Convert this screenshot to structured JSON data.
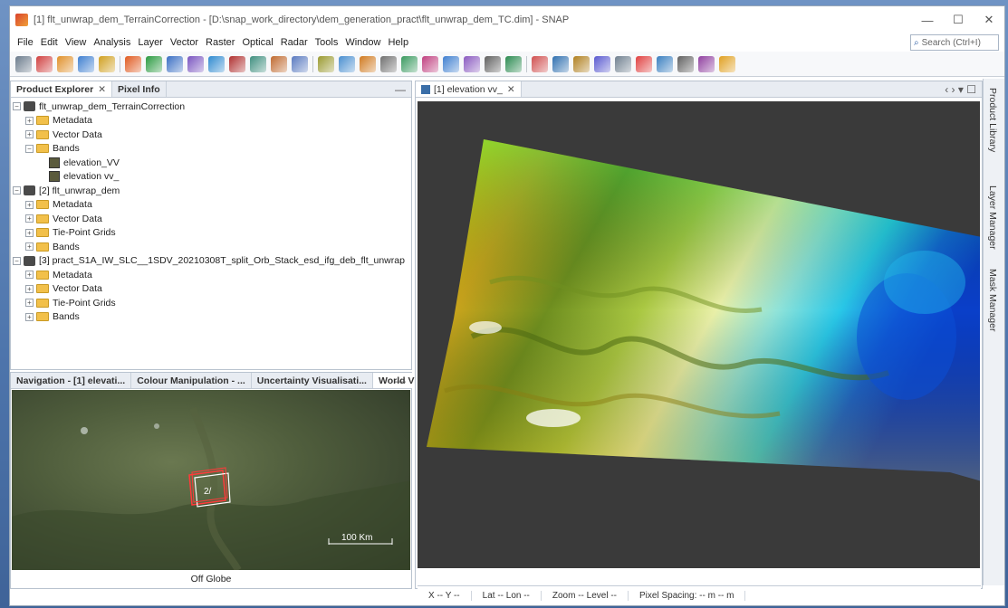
{
  "window": {
    "title": "[1] flt_unwrap_dem_TerrainCorrection - [D:\\snap_work_directory\\dem_generation_pract\\flt_unwrap_dem_TC.dim] - SNAP",
    "min_glyph": "—",
    "max_glyph": "☐",
    "close_glyph": "✕"
  },
  "menu": [
    "File",
    "Edit",
    "View",
    "Analysis",
    "Layer",
    "Vector",
    "Raster",
    "Optical",
    "Radar",
    "Tools",
    "Window",
    "Help"
  ],
  "search": {
    "placeholder": "Search (Ctrl+I)"
  },
  "product_panel": {
    "tabs": [
      {
        "label": "Product Explorer",
        "close": "✕"
      },
      {
        "label": "Pixel Info"
      }
    ],
    "tree": [
      {
        "indent": 0,
        "type": "product",
        "exp": "−",
        "label": "flt_unwrap_dem_TerrainCorrection"
      },
      {
        "indent": 1,
        "type": "folder",
        "exp": "+",
        "label": "Metadata"
      },
      {
        "indent": 1,
        "type": "folder",
        "exp": "+",
        "label": "Vector Data"
      },
      {
        "indent": 1,
        "type": "folder",
        "exp": "−",
        "label": "Bands"
      },
      {
        "indent": 2,
        "type": "band",
        "exp": "",
        "label": "elevation_VV"
      },
      {
        "indent": 2,
        "type": "band",
        "exp": "",
        "label": "elevation vv_"
      },
      {
        "indent": 0,
        "type": "product",
        "exp": "−",
        "label": "[2] flt_unwrap_dem"
      },
      {
        "indent": 1,
        "type": "folder",
        "exp": "+",
        "label": "Metadata"
      },
      {
        "indent": 1,
        "type": "folder",
        "exp": "+",
        "label": "Vector Data"
      },
      {
        "indent": 1,
        "type": "folder",
        "exp": "+",
        "label": "Tie-Point Grids"
      },
      {
        "indent": 1,
        "type": "folder",
        "exp": "+",
        "label": "Bands"
      },
      {
        "indent": 0,
        "type": "product",
        "exp": "−",
        "label": "[3] pract_S1A_IW_SLC__1SDV_20210308T_split_Orb_Stack_esd_ifg_deb_flt_unwrap"
      },
      {
        "indent": 1,
        "type": "folder",
        "exp": "+",
        "label": "Metadata"
      },
      {
        "indent": 1,
        "type": "folder",
        "exp": "+",
        "label": "Vector Data"
      },
      {
        "indent": 1,
        "type": "folder",
        "exp": "+",
        "label": "Tie-Point Grids"
      },
      {
        "indent": 1,
        "type": "folder",
        "exp": "+",
        "label": "Bands"
      }
    ]
  },
  "nav_panel": {
    "tabs": [
      "Navigation - [1] elevati...",
      "Colour Manipulation - ...",
      "Uncertainty Visualisati...",
      "World View"
    ],
    "close": "✕",
    "scale_label": "100 Km",
    "footer": "Off Globe",
    "overlay_label": "2/"
  },
  "image_view": {
    "tab_label": "[1] elevation vv_",
    "tab_close": "✕"
  },
  "side_tabs": [
    "Product Library",
    "Layer Manager",
    "Mask Manager"
  ],
  "status": {
    "xy": "X  -- Y  --",
    "latlon": "Lat   -- Lon   --",
    "zoom": "Zoom -- Level --",
    "pixel": "Pixel Spacing: -- m -- m"
  },
  "colors": {
    "accent": "#2f5fa6",
    "dem_low": "#1060d8",
    "dem_high": "#ffffff"
  }
}
